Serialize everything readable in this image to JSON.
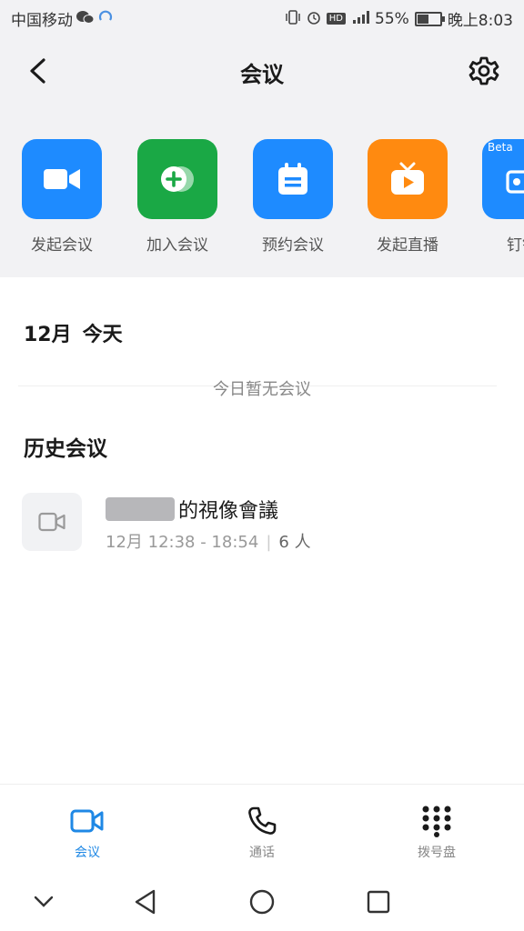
{
  "status_bar": {
    "carrier": "中国移动",
    "battery": "55%",
    "battery_level": 0.55,
    "time_label": "晚上8:03",
    "hd_badge": "HD"
  },
  "header": {
    "title": "会议",
    "back_icon": "chevron-left-icon",
    "settings_icon": "gear-icon"
  },
  "quick_actions": [
    {
      "label": "发起会议",
      "icon": "video-camera-icon",
      "color": "#1e8bff"
    },
    {
      "label": "加入会议",
      "icon": "join-plus-icon",
      "color": "#1aa845"
    },
    {
      "label": "预约会议",
      "icon": "calendar-icon",
      "color": "#1e8bff"
    },
    {
      "label": "发起直播",
      "icon": "tv-play-icon",
      "color": "#ff8a10"
    },
    {
      "label": "钉钉",
      "icon": "share-screen-icon",
      "color": "#1e8bff",
      "badge": "Beta"
    }
  ],
  "today": {
    "date": "12月",
    "today_label": "今天",
    "empty_text": "今日暂无会议"
  },
  "history": {
    "title": "历史会议",
    "items": [
      {
        "name_suffix": "的視像會議",
        "time_range": "12月 12:38 - 18:54",
        "attendees": "6 人"
      }
    ]
  },
  "bottom_nav": [
    {
      "label": "会议",
      "icon": "video-camera-icon",
      "active": true
    },
    {
      "label": "通话",
      "icon": "phone-icon",
      "active": false
    },
    {
      "label": "拨号盘",
      "icon": "dialpad-icon",
      "active": false
    }
  ],
  "colors": {
    "accent": "#1f88e5",
    "top_background": "#f2f2f4"
  }
}
